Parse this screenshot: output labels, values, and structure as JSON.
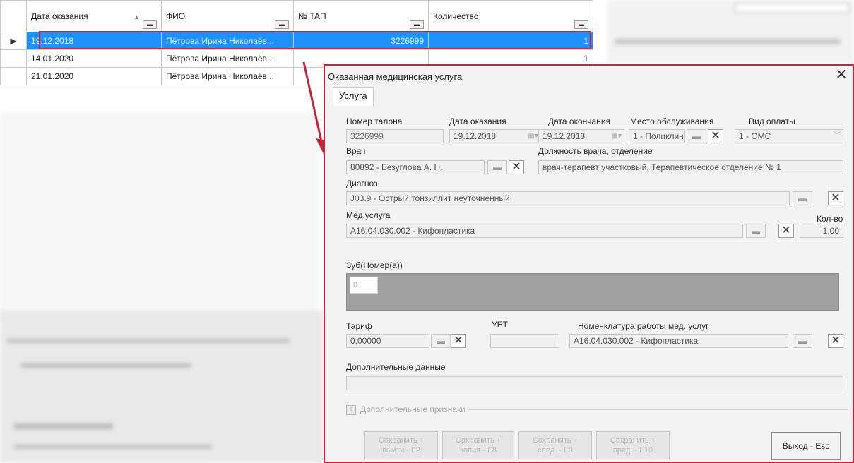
{
  "grid": {
    "columns": [
      "Дата оказания",
      "ФИО",
      "№ ТАП",
      "Количество"
    ],
    "rows": [
      {
        "date": "19.12.2018",
        "fio": "Пётрова Ирина Николаёв...",
        "tap": "3226999",
        "qty": "1"
      },
      {
        "date": "14.01.2020",
        "fio": "Пётрова Ирина Николаёв...",
        "tap": "",
        "qty": "1"
      },
      {
        "date": "21.01.2020",
        "fio": "Пётрова Ирина Николаёв...",
        "tap": "",
        "qty": ""
      }
    ],
    "selected_marker": "▶"
  },
  "dialog": {
    "title": "Оказанная медицинская услуга",
    "close": "✕",
    "tab": "Услуга",
    "fields": {
      "ticket_label": "Номер талона",
      "ticket_value": "3226999",
      "date_label": "Дата оказания",
      "date_value": "19.12.2018",
      "end_label": "Дата окончания",
      "end_value": "19.12.2018",
      "place_label": "Место обслуживания",
      "place_value": "1 - Поликлини",
      "pay_label": "Вид оплаты",
      "pay_value": "1 - ОМС",
      "doctor_label": "Врач",
      "doctor_value": "80892 - Безуглова А. Н.",
      "position_label": "Должность врача, отделение",
      "position_value": "врач-терапевт участковый, Терапевтическое отделение № 1",
      "diag_label": "Диагноз",
      "diag_value": "J03.9 - Острый тонзиллит неуточненный",
      "service_label": "Мед.услуга",
      "service_value": "A16.04.030.002 - Кифопластика",
      "count_label": "Кол-во",
      "count_value": "1,00",
      "teeth_label": "Зуб(Номер(а))",
      "teeth_value": "0",
      "tariff_label": "Тариф",
      "tariff_value": "0,00000",
      "uet_label": "УЕТ",
      "uet_value": "",
      "nomen_label": "Номенклатура работы мед. услуг",
      "nomen_value": "A16.04.030.002 - Кифопластика",
      "extra_label": "Дополнительные данные",
      "extra_value": "",
      "extra_signs": "Дополнительные признаки"
    },
    "buttons": {
      "save_exit": [
        "Сохранить +",
        "выйти - F2"
      ],
      "save_copy": [
        "Сохранить +",
        "копия - F8"
      ],
      "save_next": [
        "Сохранить +",
        "след. - F9"
      ],
      "save_prev": [
        "Сохранить +",
        "пред. - F10"
      ],
      "exit": "Выход - Esc"
    }
  }
}
